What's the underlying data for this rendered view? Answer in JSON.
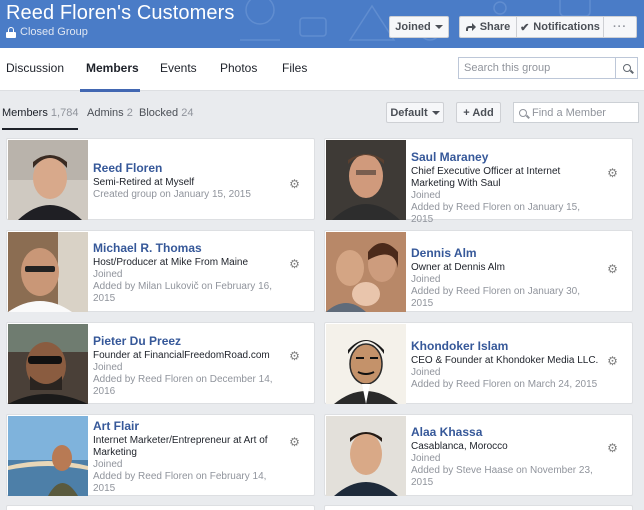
{
  "header": {
    "group_name": "Reed Floren's Customers",
    "privacy": "Closed Group",
    "joined_label": "Joined",
    "share_label": "Share",
    "notifications_label": "Notifications",
    "more_label": "···"
  },
  "nav": {
    "tabs": [
      {
        "label": "Discussion"
      },
      {
        "label": "Members"
      },
      {
        "label": "Events"
      },
      {
        "label": "Photos"
      },
      {
        "label": "Files"
      }
    ],
    "active_tab": "Members",
    "search_placeholder": "Search this group"
  },
  "members_toolbar": {
    "members_label": "Members",
    "members_count": "1,784",
    "admins_label": "Admins",
    "admins_count": "2",
    "blocked_label": "Blocked",
    "blocked_count": "24",
    "sort_label": "Default",
    "add_label": "+ Add",
    "find_placeholder": "Find a Member"
  },
  "members": [
    {
      "name": "Reed Floren",
      "line1": "Semi-Retired at Myself",
      "line2": "",
      "meta1": "Created group on January 15, 2015",
      "meta2": ""
    },
    {
      "name": "Saul Maraney",
      "line1": "Chief Executive Officer at Internet",
      "line2": "Marketing With Saul",
      "meta1": "Joined",
      "meta2": "Added by Reed Floren on January 15, 2015"
    },
    {
      "name": "Michael R. Thomas",
      "line1": "Host/Producer at Mike From Maine",
      "line2": "",
      "meta1": "Joined",
      "meta2": "Added by Milan Lukovič on February 16, 2015"
    },
    {
      "name": "Dennis Alm",
      "line1": "Owner at Dennis Alm",
      "line2": "",
      "meta1": "Joined",
      "meta2": "Added by Reed Floren on January 30, 2015"
    },
    {
      "name": "Pieter Du Preez",
      "line1": "Founder at FinancialFreedomRoad.com",
      "line2": "",
      "meta1": "Joined",
      "meta2": "Added by Reed Floren on December 14, 2016"
    },
    {
      "name": "Khondoker Islam",
      "line1": "CEO & Founder at Khondoker Media LLC.",
      "line2": "",
      "meta1": "Joined",
      "meta2": "Added by Reed Floren on March 24, 2015"
    },
    {
      "name": "Art Flair",
      "line1": "Internet Marketer/Entrepreneur at Art of",
      "line2": "Marketing",
      "meta1": "Joined",
      "meta2": "Added by Reed Floren on February 14, 2015"
    },
    {
      "name": "Alaa Khassa",
      "line1": "Casablanca, Morocco",
      "line2": "",
      "meta1": "Joined",
      "meta2": "Added by Steve Haase on November 23, 2015"
    }
  ],
  "colors": {
    "cover": "#4a7cc7",
    "link": "#365899",
    "accent": "#4267b2",
    "page_bg": "#e9ebee"
  },
  "icons": {
    "privacy": "lock-icon",
    "share": "share-icon",
    "notifications": "check-icon",
    "search": "search-icon",
    "member_settings": "gear-icon"
  }
}
